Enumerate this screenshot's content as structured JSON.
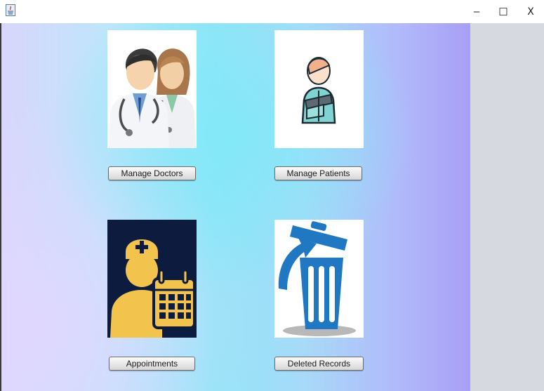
{
  "window": {
    "minimize_glyph": "–",
    "maximize_glyph": "☐",
    "close_glyph": "X"
  },
  "menu": {
    "doctors": {
      "label": "Manage Doctors",
      "icon": "doctors-icon"
    },
    "patients": {
      "label": "Manage Patients",
      "icon": "patient-icon"
    },
    "appointments": {
      "label": "Appointments",
      "icon": "appointment-calendar-icon"
    },
    "deleted": {
      "label": "Deleted Records",
      "icon": "recycle-bin-icon"
    }
  },
  "colors": {
    "accent_navy": "#0d1b3e",
    "icon_gold": "#f2c44e",
    "bin_blue": "#1f78c1",
    "side_panel": "#d6d9e0"
  }
}
